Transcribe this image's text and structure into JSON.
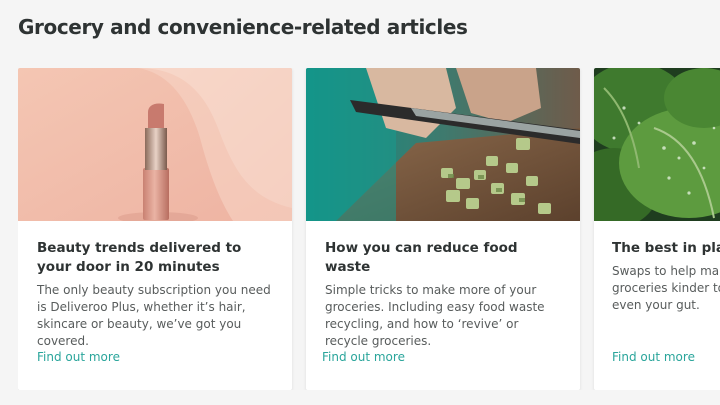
{
  "section": {
    "title": "Grocery and convenience-related articles"
  },
  "cards": [
    {
      "title": "Beauty trends delivered to your door in 20 minutes",
      "description": "The only beauty subscription you need is Deliveroo Plus, whether it’s hair, skincare or beauty, we’ve got you covered.",
      "link": "Find out more",
      "image": "lipstick-photo"
    },
    {
      "title": "How you can reduce food waste",
      "description": "Simple tricks to make more of your groceries. Including easy food waste recycling, and how to ‘revive’ or recycle groceries.",
      "link": "Find out more",
      "image": "chopping-vegetables-photo"
    },
    {
      "title": "The best in plant",
      "description_lines": [
        "Swaps to help make",
        "groceries kinder to t",
        "even your gut."
      ],
      "link": "Find out more",
      "image": "leafy-greens-photo"
    }
  ],
  "colors": {
    "background": "#f5f5f5",
    "card": "#ffffff",
    "title": "#2e3333",
    "body": "#585c5c",
    "link": "#2aa59b"
  }
}
